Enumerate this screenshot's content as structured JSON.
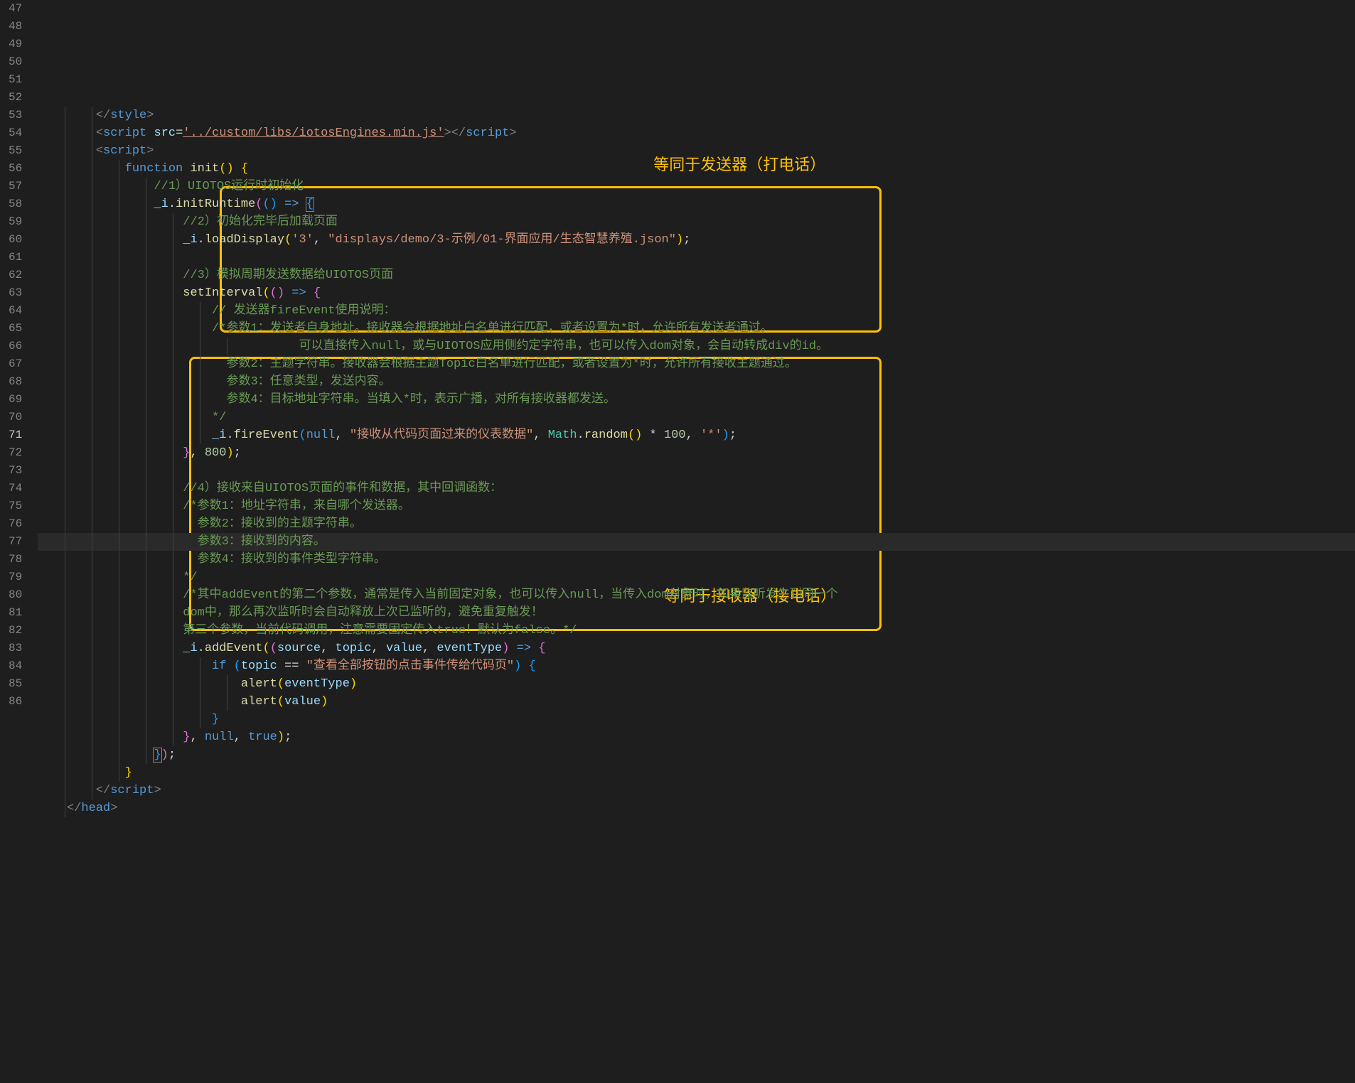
{
  "lineStart": 47,
  "currentLine": 71,
  "annotations": {
    "label1": "等同于发送器（打电话）",
    "label2": "等同于接收器（接电话）"
  },
  "code": {
    "47": [
      {
        "c": "tag",
        "t": "</"
      },
      {
        "c": "tagname",
        "t": "style"
      },
      {
        "c": "tag",
        "t": ">"
      }
    ],
    "48": [
      {
        "c": "tag",
        "t": "<"
      },
      {
        "c": "tagname",
        "t": "script "
      },
      {
        "c": "attr",
        "t": "src"
      },
      {
        "c": "op",
        "t": "="
      },
      {
        "c": "strU",
        "t": "'../custom/libs/iotosEngines.min.js'"
      },
      {
        "c": "tag",
        "t": ">"
      },
      {
        "c": "tag",
        "t": "</"
      },
      {
        "c": "tagname",
        "t": "script"
      },
      {
        "c": "tag",
        "t": ">"
      }
    ],
    "49": [
      {
        "c": "tag",
        "t": "<"
      },
      {
        "c": "tagname",
        "t": "script"
      },
      {
        "c": "tag",
        "t": ">"
      }
    ],
    "50": [
      {
        "c": "kw",
        "t": "function "
      },
      {
        "c": "fn",
        "t": "init"
      },
      {
        "c": "paren1",
        "t": "()"
      },
      {
        "c": "punct",
        "t": " "
      },
      {
        "c": "paren1",
        "t": "{"
      }
    ],
    "51": [
      {
        "c": "cmt",
        "t": "//1）UIOTOS运行时初始化"
      }
    ],
    "52": [
      {
        "c": "var",
        "t": "_i"
      },
      {
        "c": "op",
        "t": "."
      },
      {
        "c": "fn",
        "t": "initRuntime"
      },
      {
        "c": "paren2",
        "t": "("
      },
      {
        "c": "paren3",
        "t": "()"
      },
      {
        "c": "op",
        "t": " "
      },
      {
        "c": "kw",
        "t": "=>"
      },
      {
        "c": "op",
        "t": " "
      },
      {
        "c": "paren3 bracket-match",
        "t": "{"
      }
    ],
    "53": [
      {
        "c": "cmt",
        "t": "//2）初始化完毕后加载页面"
      }
    ],
    "54": [
      {
        "c": "var",
        "t": "_i"
      },
      {
        "c": "op",
        "t": "."
      },
      {
        "c": "fn",
        "t": "loadDisplay"
      },
      {
        "c": "paren1",
        "t": "("
      },
      {
        "c": "str",
        "t": "'3'"
      },
      {
        "c": "op",
        "t": ", "
      },
      {
        "c": "str",
        "t": "\"displays/demo/3-示例/01-界面应用/生态智慧养殖.json\""
      },
      {
        "c": "paren1",
        "t": ")"
      },
      {
        "c": "op",
        "t": ";"
      }
    ],
    "55": [],
    "56": [
      {
        "c": "cmt",
        "t": "//3）模拟周期发送数据给UIOTOS页面"
      }
    ],
    "57": [
      {
        "c": "fn",
        "t": "setInterval"
      },
      {
        "c": "paren1",
        "t": "("
      },
      {
        "c": "paren2",
        "t": "()"
      },
      {
        "c": "op",
        "t": " "
      },
      {
        "c": "kw",
        "t": "=>"
      },
      {
        "c": "op",
        "t": " "
      },
      {
        "c": "paren2",
        "t": "{"
      }
    ],
    "58": [
      {
        "c": "cmt",
        "t": "// 发送器fireEvent使用说明："
      }
    ],
    "59": [
      {
        "c": "cmt",
        "t": "/*参数1：发送者自身地址。接收器会根据地址白名单进行匹配，或者设置为*时，允许所有发送者通过。"
      }
    ],
    "60": [
      {
        "c": "cmt",
        "t": "        可以直接传入null，或与UIOTOS应用侧约定字符串，也可以传入dom对象，会自动转成div的id。"
      }
    ],
    "61": [
      {
        "c": "cmt",
        "t": "  参数2：主题字符串。接收器会根据主题Topic白名单进行匹配，或者设置为*时，允许所有接收主题通过。"
      }
    ],
    "62": [
      {
        "c": "cmt",
        "t": "  参数3：任意类型，发送内容。"
      }
    ],
    "63": [
      {
        "c": "cmt",
        "t": "  参数4：目标地址字符串。当填入*时，表示广播，对所有接收器都发送。"
      }
    ],
    "64": [
      {
        "c": "cmt",
        "t": "*/"
      }
    ],
    "65": [
      {
        "c": "var",
        "t": "_i"
      },
      {
        "c": "op",
        "t": "."
      },
      {
        "c": "fn",
        "t": "fireEvent"
      },
      {
        "c": "paren3",
        "t": "("
      },
      {
        "c": "kw",
        "t": "null"
      },
      {
        "c": "op",
        "t": ", "
      },
      {
        "c": "str",
        "t": "\"接收从代码页面过来的仪表数据\""
      },
      {
        "c": "op",
        "t": ", "
      },
      {
        "c": "cls",
        "t": "Math"
      },
      {
        "c": "op",
        "t": "."
      },
      {
        "c": "fn",
        "t": "random"
      },
      {
        "c": "paren1",
        "t": "()"
      },
      {
        "c": "op",
        "t": " * "
      },
      {
        "c": "num",
        "t": "100"
      },
      {
        "c": "op",
        "t": ", "
      },
      {
        "c": "str",
        "t": "'*'"
      },
      {
        "c": "paren3",
        "t": ")"
      },
      {
        "c": "op",
        "t": ";"
      }
    ],
    "66": [
      {
        "c": "paren2",
        "t": "}"
      },
      {
        "c": "op",
        "t": ", "
      },
      {
        "c": "num",
        "t": "800"
      },
      {
        "c": "paren1",
        "t": ")"
      },
      {
        "c": "op",
        "t": ";"
      }
    ],
    "67": [],
    "68": [
      {
        "c": "cmt",
        "t": "//4）接收来自UIOTOS页面的事件和数据，其中回调函数："
      }
    ],
    "69": [
      {
        "c": "cmt",
        "t": "/*参数1：地址字符串，来自哪个发送器。"
      }
    ],
    "70": [
      {
        "c": "cmt",
        "t": "  参数2：接收到的主题字符串。"
      }
    ],
    "71": [
      {
        "c": "cmt",
        "t": "  参数3：接收到的内容。"
      }
    ],
    "72": [
      {
        "c": "cmt",
        "t": "  参数4：接收到的事件类型字符串。"
      }
    ],
    "73": [
      {
        "c": "cmt",
        "t": "*/"
      }
    ],
    "74": [
      {
        "c": "cmt",
        "t": "/*其中addEvent的第二个参数，通常是传入当前固定对象，也可以传入null，当传入dom对象时，如果监听发生到同一个"
      }
    ],
    "75": [
      {
        "c": "cmt",
        "t": "dom中，那么再次监听时会自动释放上次已监听的，避免重复触发！"
      }
    ],
    "76": [
      {
        "c": "cmt",
        "t": "第三个参数，当前代码调用，注意需要固定传入true！默认为false。*/"
      }
    ],
    "77": [
      {
        "c": "var",
        "t": "_i"
      },
      {
        "c": "op",
        "t": "."
      },
      {
        "c": "fn",
        "t": "addEvent"
      },
      {
        "c": "paren1",
        "t": "("
      },
      {
        "c": "paren2",
        "t": "("
      },
      {
        "c": "var",
        "t": "source"
      },
      {
        "c": "op",
        "t": ", "
      },
      {
        "c": "var",
        "t": "topic"
      },
      {
        "c": "op",
        "t": ", "
      },
      {
        "c": "var",
        "t": "value"
      },
      {
        "c": "op",
        "t": ", "
      },
      {
        "c": "var",
        "t": "eventType"
      },
      {
        "c": "paren2",
        "t": ")"
      },
      {
        "c": "op",
        "t": " "
      },
      {
        "c": "kw",
        "t": "=>"
      },
      {
        "c": "op",
        "t": " "
      },
      {
        "c": "paren2",
        "t": "{"
      }
    ],
    "78": [
      {
        "c": "kw",
        "t": "if"
      },
      {
        "c": "op",
        "t": " "
      },
      {
        "c": "paren3",
        "t": "("
      },
      {
        "c": "var",
        "t": "topic"
      },
      {
        "c": "op",
        "t": " == "
      },
      {
        "c": "str",
        "t": "\"查看全部按钮的点击事件传给代码页\""
      },
      {
        "c": "paren3",
        "t": ")"
      },
      {
        "c": "op",
        "t": " "
      },
      {
        "c": "paren3",
        "t": "{"
      }
    ],
    "79": [
      {
        "c": "fn",
        "t": "alert"
      },
      {
        "c": "paren1",
        "t": "("
      },
      {
        "c": "var",
        "t": "eventType"
      },
      {
        "c": "paren1",
        "t": ")"
      }
    ],
    "80": [
      {
        "c": "fn",
        "t": "alert"
      },
      {
        "c": "paren1",
        "t": "("
      },
      {
        "c": "var",
        "t": "value"
      },
      {
        "c": "paren1",
        "t": ")"
      }
    ],
    "81": [
      {
        "c": "paren3",
        "t": "}"
      }
    ],
    "82": [
      {
        "c": "paren2",
        "t": "}"
      },
      {
        "c": "op",
        "t": ", "
      },
      {
        "c": "kw",
        "t": "null"
      },
      {
        "c": "op",
        "t": ", "
      },
      {
        "c": "kw",
        "t": "true"
      },
      {
        "c": "paren1",
        "t": ")"
      },
      {
        "c": "op",
        "t": ";"
      }
    ],
    "83": [
      {
        "c": "paren3 bracket-match",
        "t": "}"
      },
      {
        "c": "paren2",
        "t": ")"
      },
      {
        "c": "op",
        "t": ";"
      }
    ],
    "84": [
      {
        "c": "paren1",
        "t": "}"
      }
    ],
    "85": [
      {
        "c": "tag",
        "t": "</"
      },
      {
        "c": "tagname",
        "t": "script"
      },
      {
        "c": "tag",
        "t": ">"
      }
    ],
    "86": [
      {
        "c": "tag",
        "t": "</"
      },
      {
        "c": "tagname",
        "t": "head"
      },
      {
        "c": "tag",
        "t": ">"
      }
    ]
  },
  "indents": {
    "47": 2,
    "48": 2,
    "49": 2,
    "50": 3,
    "51": 4,
    "52": 4,
    "53": 5,
    "54": 5,
    "55": 0,
    "56": 5,
    "57": 5,
    "58": 6,
    "59": 6,
    "60": 7,
    "61": 6,
    "62": 6,
    "63": 6,
    "64": 6,
    "65": 6,
    "66": 5,
    "67": 0,
    "68": 5,
    "69": 5,
    "70": 5,
    "71": 5,
    "72": 5,
    "73": 5,
    "74": 5,
    "75": 5,
    "76": 5,
    "77": 5,
    "78": 6,
    "79": 7,
    "80": 7,
    "81": 6,
    "82": 5,
    "83": 4,
    "84": 3,
    "85": 2,
    "86": 1
  },
  "guides": {
    "47": [
      1,
      2
    ],
    "48": [
      1,
      2
    ],
    "49": [
      1,
      2
    ],
    "50": [
      1,
      2,
      3
    ],
    "51": [
      1,
      2,
      3,
      4
    ],
    "52": [
      1,
      2,
      3,
      4
    ],
    "53": [
      1,
      2,
      3,
      4,
      5
    ],
    "54": [
      1,
      2,
      3,
      4,
      5
    ],
    "55": [
      1,
      2,
      3,
      4,
      5
    ],
    "56": [
      1,
      2,
      3,
      4,
      5
    ],
    "57": [
      1,
      2,
      3,
      4,
      5
    ],
    "58": [
      1,
      2,
      3,
      4,
      5,
      6
    ],
    "59": [
      1,
      2,
      3,
      4,
      5,
      6
    ],
    "60": [
      1,
      2,
      3,
      4,
      5,
      6,
      7
    ],
    "61": [
      1,
      2,
      3,
      4,
      5,
      6
    ],
    "62": [
      1,
      2,
      3,
      4,
      5,
      6
    ],
    "63": [
      1,
      2,
      3,
      4,
      5,
      6
    ],
    "64": [
      1,
      2,
      3,
      4,
      5,
      6
    ],
    "65": [
      1,
      2,
      3,
      4,
      5,
      6
    ],
    "66": [
      1,
      2,
      3,
      4,
      5
    ],
    "67": [
      1,
      2,
      3,
      4,
      5
    ],
    "68": [
      1,
      2,
      3,
      4,
      5
    ],
    "69": [
      1,
      2,
      3,
      4,
      5
    ],
    "70": [
      1,
      2,
      3,
      4,
      5
    ],
    "71": [
      1,
      2,
      3,
      4,
      5
    ],
    "72": [
      1,
      2,
      3,
      4,
      5
    ],
    "73": [
      1,
      2,
      3,
      4,
      5
    ],
    "74": [
      1,
      2,
      3,
      4,
      5
    ],
    "75": [
      1,
      2,
      3,
      4,
      5
    ],
    "76": [
      1,
      2,
      3,
      4,
      5
    ],
    "77": [
      1,
      2,
      3,
      4,
      5
    ],
    "78": [
      1,
      2,
      3,
      4,
      5,
      6
    ],
    "79": [
      1,
      2,
      3,
      4,
      5,
      6,
      7
    ],
    "80": [
      1,
      2,
      3,
      4,
      5,
      6,
      7
    ],
    "81": [
      1,
      2,
      3,
      4,
      5,
      6
    ],
    "82": [
      1,
      2,
      3,
      4,
      5
    ],
    "83": [
      1,
      2,
      3,
      4
    ],
    "84": [
      1,
      2,
      3
    ],
    "85": [
      1,
      2
    ],
    "86": [
      1
    ]
  }
}
